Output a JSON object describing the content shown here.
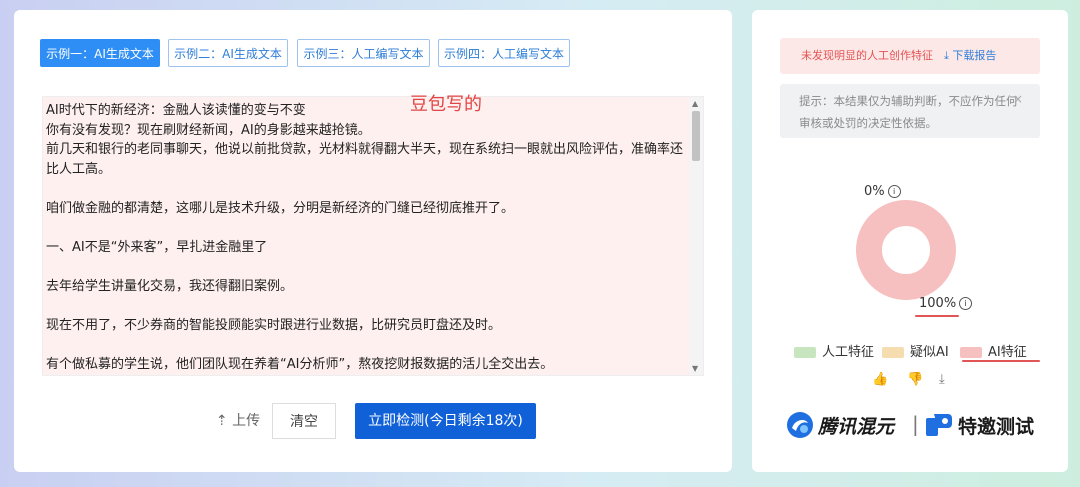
{
  "tabs": [
    {
      "label": "示例一：AI生成文本",
      "active": true
    },
    {
      "label": "示例二：AI生成文本",
      "active": false
    },
    {
      "label": "示例三：人工编写文本",
      "active": false
    },
    {
      "label": "示例四：人工编写文本",
      "active": false
    }
  ],
  "editor": {
    "text": "AI时代下的新经济：金融人该读懂的变与不变\n你有没有发现？现在刷财经新闻，AI的身影越来越抢镜。\n前几天和银行的老同事聊天，他说以前批贷款，光材料就得翻大半天，现在系统扫一眼就出风险评估，准确率还比人工高。\n\n咱们做金融的都清楚，这哪儿是技术升级，分明是新经济的门缝已经彻底推开了。\n\n一、AI不是“外来客”，早扎进金融里了\n\n去年给学生讲量化交易，我还得翻旧案例。\n\n现在不用了，不少券商的智能投顾能实时跟进行业数据，比研究员盯盘还及时。\n\n有个做私募的学生说，他们团队现在养着“AI分析师”，熬夜挖财报数据的活儿全交出去。"
  },
  "annotation": "豆包写的",
  "actions": {
    "upload": "上传",
    "clear": "清空",
    "detect": "立即检测(今日剩余18次)"
  },
  "result": {
    "alert": "未发现明显的人工创作特征",
    "download": "下载报告",
    "notice": "提示：本结果仅为辅助判断，不应作为任何审核或处罚的决定性依据。",
    "close_icon": "×"
  },
  "donut": {
    "top_label": "0%",
    "bottom_label": "100%",
    "info_icon": "i"
  },
  "legend": [
    {
      "label": "人工特征",
      "color": "#c7e6bf"
    },
    {
      "label": "疑似AI",
      "color": "#f5ddb0"
    },
    {
      "label": "AI特征",
      "color": "#f7c0c0"
    }
  ],
  "chart_data": {
    "type": "pie",
    "categories": [
      "人工特征",
      "疑似AI",
      "AI特征"
    ],
    "values": [
      0,
      0,
      100
    ],
    "colors": [
      "#c7e6bf",
      "#f5ddb0",
      "#f7c0c0"
    ]
  },
  "brand": {
    "left": "腾讯混元",
    "separator": "|",
    "right": "特邀测试"
  },
  "icons": {
    "thumbs_up": "👍",
    "thumbs_down": "👎",
    "download": "⤓",
    "upload": "⇡"
  },
  "accent": "#1060d8"
}
